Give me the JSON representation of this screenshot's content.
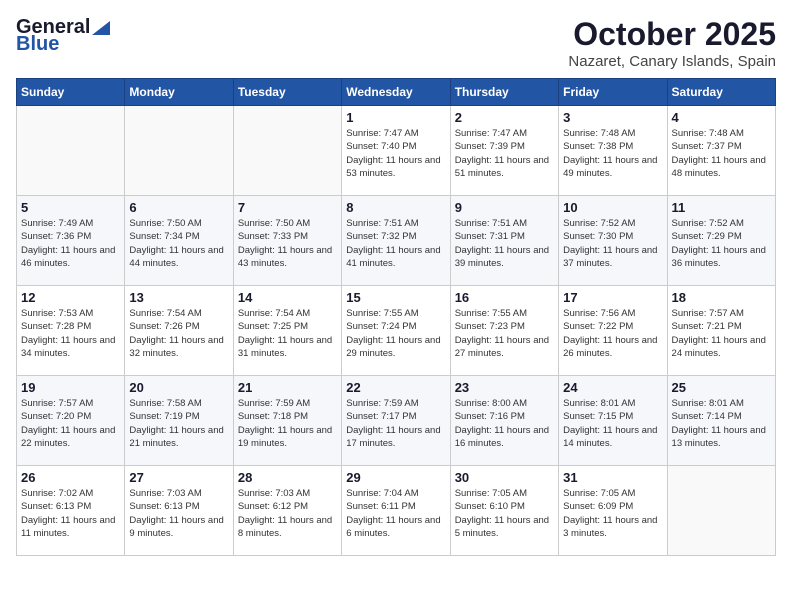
{
  "header": {
    "logo_general": "General",
    "logo_blue": "Blue",
    "month": "October 2025",
    "location": "Nazaret, Canary Islands, Spain"
  },
  "weekdays": [
    "Sunday",
    "Monday",
    "Tuesday",
    "Wednesday",
    "Thursday",
    "Friday",
    "Saturday"
  ],
  "weeks": [
    [
      {
        "day": "",
        "info": ""
      },
      {
        "day": "",
        "info": ""
      },
      {
        "day": "",
        "info": ""
      },
      {
        "day": "1",
        "info": "Sunrise: 7:47 AM\nSunset: 7:40 PM\nDaylight: 11 hours and 53 minutes."
      },
      {
        "day": "2",
        "info": "Sunrise: 7:47 AM\nSunset: 7:39 PM\nDaylight: 11 hours and 51 minutes."
      },
      {
        "day": "3",
        "info": "Sunrise: 7:48 AM\nSunset: 7:38 PM\nDaylight: 11 hours and 49 minutes."
      },
      {
        "day": "4",
        "info": "Sunrise: 7:48 AM\nSunset: 7:37 PM\nDaylight: 11 hours and 48 minutes."
      }
    ],
    [
      {
        "day": "5",
        "info": "Sunrise: 7:49 AM\nSunset: 7:36 PM\nDaylight: 11 hours and 46 minutes."
      },
      {
        "day": "6",
        "info": "Sunrise: 7:50 AM\nSunset: 7:34 PM\nDaylight: 11 hours and 44 minutes."
      },
      {
        "day": "7",
        "info": "Sunrise: 7:50 AM\nSunset: 7:33 PM\nDaylight: 11 hours and 43 minutes."
      },
      {
        "day": "8",
        "info": "Sunrise: 7:51 AM\nSunset: 7:32 PM\nDaylight: 11 hours and 41 minutes."
      },
      {
        "day": "9",
        "info": "Sunrise: 7:51 AM\nSunset: 7:31 PM\nDaylight: 11 hours and 39 minutes."
      },
      {
        "day": "10",
        "info": "Sunrise: 7:52 AM\nSunset: 7:30 PM\nDaylight: 11 hours and 37 minutes."
      },
      {
        "day": "11",
        "info": "Sunrise: 7:52 AM\nSunset: 7:29 PM\nDaylight: 11 hours and 36 minutes."
      }
    ],
    [
      {
        "day": "12",
        "info": "Sunrise: 7:53 AM\nSunset: 7:28 PM\nDaylight: 11 hours and 34 minutes."
      },
      {
        "day": "13",
        "info": "Sunrise: 7:54 AM\nSunset: 7:26 PM\nDaylight: 11 hours and 32 minutes."
      },
      {
        "day": "14",
        "info": "Sunrise: 7:54 AM\nSunset: 7:25 PM\nDaylight: 11 hours and 31 minutes."
      },
      {
        "day": "15",
        "info": "Sunrise: 7:55 AM\nSunset: 7:24 PM\nDaylight: 11 hours and 29 minutes."
      },
      {
        "day": "16",
        "info": "Sunrise: 7:55 AM\nSunset: 7:23 PM\nDaylight: 11 hours and 27 minutes."
      },
      {
        "day": "17",
        "info": "Sunrise: 7:56 AM\nSunset: 7:22 PM\nDaylight: 11 hours and 26 minutes."
      },
      {
        "day": "18",
        "info": "Sunrise: 7:57 AM\nSunset: 7:21 PM\nDaylight: 11 hours and 24 minutes."
      }
    ],
    [
      {
        "day": "19",
        "info": "Sunrise: 7:57 AM\nSunset: 7:20 PM\nDaylight: 11 hours and 22 minutes."
      },
      {
        "day": "20",
        "info": "Sunrise: 7:58 AM\nSunset: 7:19 PM\nDaylight: 11 hours and 21 minutes."
      },
      {
        "day": "21",
        "info": "Sunrise: 7:59 AM\nSunset: 7:18 PM\nDaylight: 11 hours and 19 minutes."
      },
      {
        "day": "22",
        "info": "Sunrise: 7:59 AM\nSunset: 7:17 PM\nDaylight: 11 hours and 17 minutes."
      },
      {
        "day": "23",
        "info": "Sunrise: 8:00 AM\nSunset: 7:16 PM\nDaylight: 11 hours and 16 minutes."
      },
      {
        "day": "24",
        "info": "Sunrise: 8:01 AM\nSunset: 7:15 PM\nDaylight: 11 hours and 14 minutes."
      },
      {
        "day": "25",
        "info": "Sunrise: 8:01 AM\nSunset: 7:14 PM\nDaylight: 11 hours and 13 minutes."
      }
    ],
    [
      {
        "day": "26",
        "info": "Sunrise: 7:02 AM\nSunset: 6:13 PM\nDaylight: 11 hours and 11 minutes."
      },
      {
        "day": "27",
        "info": "Sunrise: 7:03 AM\nSunset: 6:13 PM\nDaylight: 11 hours and 9 minutes."
      },
      {
        "day": "28",
        "info": "Sunrise: 7:03 AM\nSunset: 6:12 PM\nDaylight: 11 hours and 8 minutes."
      },
      {
        "day": "29",
        "info": "Sunrise: 7:04 AM\nSunset: 6:11 PM\nDaylight: 11 hours and 6 minutes."
      },
      {
        "day": "30",
        "info": "Sunrise: 7:05 AM\nSunset: 6:10 PM\nDaylight: 11 hours and 5 minutes."
      },
      {
        "day": "31",
        "info": "Sunrise: 7:05 AM\nSunset: 6:09 PM\nDaylight: 11 hours and 3 minutes."
      },
      {
        "day": "",
        "info": ""
      }
    ]
  ]
}
